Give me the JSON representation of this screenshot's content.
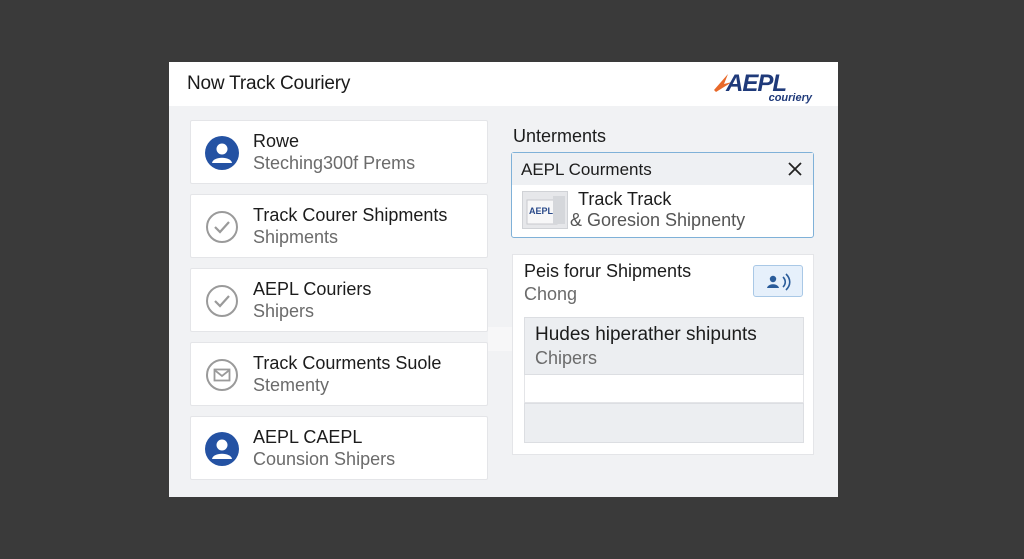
{
  "app": {
    "title": "Now Track Couriery",
    "logo_text": "AEPL",
    "logo_sub": "couriery"
  },
  "colors": {
    "accent_orange": "#e8692a",
    "brand_blue": "#1f3a7a",
    "avatar_blue": "#2452a3",
    "dialog_border": "#7fb1d8"
  },
  "left_list": [
    {
      "icon": "user-avatar-icon",
      "title": "Rowe",
      "subtitle": "Steching300f Prems"
    },
    {
      "icon": "check-circle-icon",
      "title": "Track Courer Shipments",
      "subtitle": "Shipments"
    },
    {
      "icon": "check-circle-icon",
      "title": "AEPL Couriers",
      "subtitle": "Shipers"
    },
    {
      "icon": "mail-icon",
      "title": "Track Courments Suole",
      "subtitle": "Stementy"
    },
    {
      "icon": "user-avatar-icon",
      "title": "AEPL CAEPL",
      "subtitle": "Counsion Shipers"
    }
  ],
  "right": {
    "heading": "Unterments",
    "dialog": {
      "title": "AEPL Courments",
      "close_icon": "close-icon",
      "thumb_label": "AEPL",
      "line1": "Track Track",
      "line2": "& Goresion Shipnenty"
    },
    "panel": {
      "title": "Peis forur Shipments",
      "subtitle": "Chong",
      "button_icon": "contact-signal-icon",
      "result_title": "Hudes hiperather shipunts",
      "result_subtitle": "Chipers"
    }
  }
}
